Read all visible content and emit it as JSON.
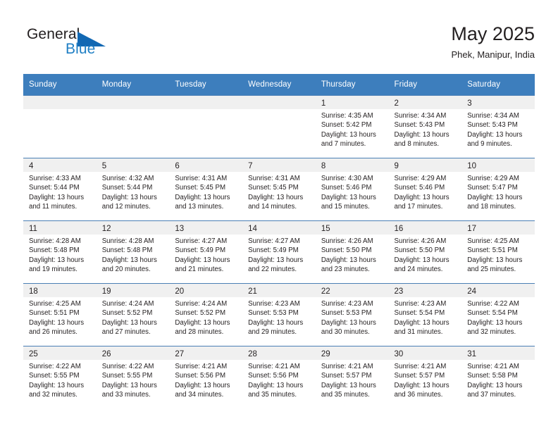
{
  "brand": {
    "name_part1": "General",
    "name_part2": "Blue",
    "triangle_color": "#1268b3",
    "blue_color": "#1f7fc4"
  },
  "header": {
    "title": "May 2025",
    "location": "Phek, Manipur, India"
  },
  "theme": {
    "header_bg": "#3d7ebd",
    "header_text": "#ffffff",
    "daynum_band_bg": "#f0f0f0",
    "cell_bg": "#ffffff",
    "row_border": "#4a7fb5",
    "text": "#231f20"
  },
  "weekday_headers": [
    "Sunday",
    "Monday",
    "Tuesday",
    "Wednesday",
    "Thursday",
    "Friday",
    "Saturday"
  ],
  "labels": {
    "sunrise": "Sunrise:",
    "sunset": "Sunset:",
    "daylight": "Daylight:"
  },
  "weeks": [
    [
      {
        "day": "",
        "line1": "",
        "line2": "",
        "line3": "",
        "line4": "",
        "empty": true
      },
      {
        "day": "",
        "line1": "",
        "line2": "",
        "line3": "",
        "line4": "",
        "empty": true
      },
      {
        "day": "",
        "line1": "",
        "line2": "",
        "line3": "",
        "line4": "",
        "empty": true
      },
      {
        "day": "",
        "line1": "",
        "line2": "",
        "line3": "",
        "line4": "",
        "empty": true
      },
      {
        "day": "1",
        "line1": "Sunrise: 4:35 AM",
        "line2": "Sunset: 5:42 PM",
        "line3": "Daylight: 13 hours",
        "line4": "and 7 minutes."
      },
      {
        "day": "2",
        "line1": "Sunrise: 4:34 AM",
        "line2": "Sunset: 5:43 PM",
        "line3": "Daylight: 13 hours",
        "line4": "and 8 minutes."
      },
      {
        "day": "3",
        "line1": "Sunrise: 4:34 AM",
        "line2": "Sunset: 5:43 PM",
        "line3": "Daylight: 13 hours",
        "line4": "and 9 minutes."
      }
    ],
    [
      {
        "day": "4",
        "line1": "Sunrise: 4:33 AM",
        "line2": "Sunset: 5:44 PM",
        "line3": "Daylight: 13 hours",
        "line4": "and 11 minutes."
      },
      {
        "day": "5",
        "line1": "Sunrise: 4:32 AM",
        "line2": "Sunset: 5:44 PM",
        "line3": "Daylight: 13 hours",
        "line4": "and 12 minutes."
      },
      {
        "day": "6",
        "line1": "Sunrise: 4:31 AM",
        "line2": "Sunset: 5:45 PM",
        "line3": "Daylight: 13 hours",
        "line4": "and 13 minutes."
      },
      {
        "day": "7",
        "line1": "Sunrise: 4:31 AM",
        "line2": "Sunset: 5:45 PM",
        "line3": "Daylight: 13 hours",
        "line4": "and 14 minutes."
      },
      {
        "day": "8",
        "line1": "Sunrise: 4:30 AM",
        "line2": "Sunset: 5:46 PM",
        "line3": "Daylight: 13 hours",
        "line4": "and 15 minutes."
      },
      {
        "day": "9",
        "line1": "Sunrise: 4:29 AM",
        "line2": "Sunset: 5:46 PM",
        "line3": "Daylight: 13 hours",
        "line4": "and 17 minutes."
      },
      {
        "day": "10",
        "line1": "Sunrise: 4:29 AM",
        "line2": "Sunset: 5:47 PM",
        "line3": "Daylight: 13 hours",
        "line4": "and 18 minutes."
      }
    ],
    [
      {
        "day": "11",
        "line1": "Sunrise: 4:28 AM",
        "line2": "Sunset: 5:48 PM",
        "line3": "Daylight: 13 hours",
        "line4": "and 19 minutes."
      },
      {
        "day": "12",
        "line1": "Sunrise: 4:28 AM",
        "line2": "Sunset: 5:48 PM",
        "line3": "Daylight: 13 hours",
        "line4": "and 20 minutes."
      },
      {
        "day": "13",
        "line1": "Sunrise: 4:27 AM",
        "line2": "Sunset: 5:49 PM",
        "line3": "Daylight: 13 hours",
        "line4": "and 21 minutes."
      },
      {
        "day": "14",
        "line1": "Sunrise: 4:27 AM",
        "line2": "Sunset: 5:49 PM",
        "line3": "Daylight: 13 hours",
        "line4": "and 22 minutes."
      },
      {
        "day": "15",
        "line1": "Sunrise: 4:26 AM",
        "line2": "Sunset: 5:50 PM",
        "line3": "Daylight: 13 hours",
        "line4": "and 23 minutes."
      },
      {
        "day": "16",
        "line1": "Sunrise: 4:26 AM",
        "line2": "Sunset: 5:50 PM",
        "line3": "Daylight: 13 hours",
        "line4": "and 24 minutes."
      },
      {
        "day": "17",
        "line1": "Sunrise: 4:25 AM",
        "line2": "Sunset: 5:51 PM",
        "line3": "Daylight: 13 hours",
        "line4": "and 25 minutes."
      }
    ],
    [
      {
        "day": "18",
        "line1": "Sunrise: 4:25 AM",
        "line2": "Sunset: 5:51 PM",
        "line3": "Daylight: 13 hours",
        "line4": "and 26 minutes."
      },
      {
        "day": "19",
        "line1": "Sunrise: 4:24 AM",
        "line2": "Sunset: 5:52 PM",
        "line3": "Daylight: 13 hours",
        "line4": "and 27 minutes."
      },
      {
        "day": "20",
        "line1": "Sunrise: 4:24 AM",
        "line2": "Sunset: 5:52 PM",
        "line3": "Daylight: 13 hours",
        "line4": "and 28 minutes."
      },
      {
        "day": "21",
        "line1": "Sunrise: 4:23 AM",
        "line2": "Sunset: 5:53 PM",
        "line3": "Daylight: 13 hours",
        "line4": "and 29 minutes."
      },
      {
        "day": "22",
        "line1": "Sunrise: 4:23 AM",
        "line2": "Sunset: 5:53 PM",
        "line3": "Daylight: 13 hours",
        "line4": "and 30 minutes."
      },
      {
        "day": "23",
        "line1": "Sunrise: 4:23 AM",
        "line2": "Sunset: 5:54 PM",
        "line3": "Daylight: 13 hours",
        "line4": "and 31 minutes."
      },
      {
        "day": "24",
        "line1": "Sunrise: 4:22 AM",
        "line2": "Sunset: 5:54 PM",
        "line3": "Daylight: 13 hours",
        "line4": "and 32 minutes."
      }
    ],
    [
      {
        "day": "25",
        "line1": "Sunrise: 4:22 AM",
        "line2": "Sunset: 5:55 PM",
        "line3": "Daylight: 13 hours",
        "line4": "and 32 minutes."
      },
      {
        "day": "26",
        "line1": "Sunrise: 4:22 AM",
        "line2": "Sunset: 5:55 PM",
        "line3": "Daylight: 13 hours",
        "line4": "and 33 minutes."
      },
      {
        "day": "27",
        "line1": "Sunrise: 4:21 AM",
        "line2": "Sunset: 5:56 PM",
        "line3": "Daylight: 13 hours",
        "line4": "and 34 minutes."
      },
      {
        "day": "28",
        "line1": "Sunrise: 4:21 AM",
        "line2": "Sunset: 5:56 PM",
        "line3": "Daylight: 13 hours",
        "line4": "and 35 minutes."
      },
      {
        "day": "29",
        "line1": "Sunrise: 4:21 AM",
        "line2": "Sunset: 5:57 PM",
        "line3": "Daylight: 13 hours",
        "line4": "and 35 minutes."
      },
      {
        "day": "30",
        "line1": "Sunrise: 4:21 AM",
        "line2": "Sunset: 5:57 PM",
        "line3": "Daylight: 13 hours",
        "line4": "and 36 minutes."
      },
      {
        "day": "31",
        "line1": "Sunrise: 4:21 AM",
        "line2": "Sunset: 5:58 PM",
        "line3": "Daylight: 13 hours",
        "line4": "and 37 minutes."
      }
    ]
  ]
}
